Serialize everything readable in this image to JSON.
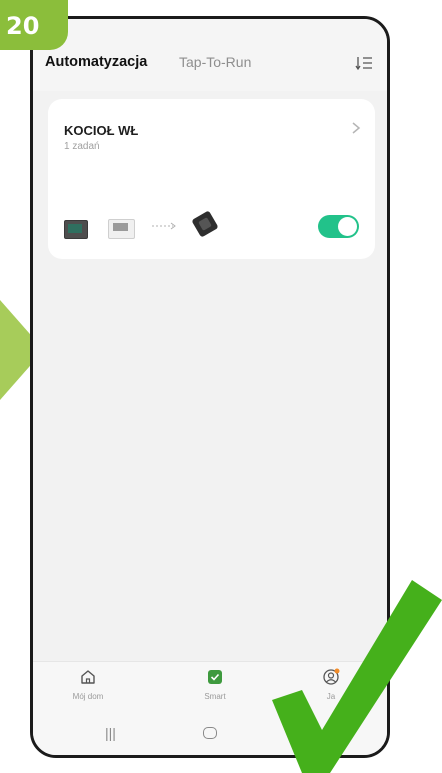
{
  "step": {
    "number": "20"
  },
  "header": {
    "tabs": [
      {
        "label": "Automatyzacja",
        "active": true
      },
      {
        "label": "Tap-To-Run",
        "active": false
      }
    ],
    "sort_icon": "sort-list-icon"
  },
  "automation_card": {
    "title": "KOCIOŁ WŁ",
    "subtitle": "1 zadań",
    "toggle_on": true,
    "toggle_color": "#22c28a"
  },
  "bottom_nav": {
    "items": [
      {
        "label": "Mój dom",
        "icon": "home-icon"
      },
      {
        "label": "Smart",
        "icon": "smart-check-icon"
      },
      {
        "label": "Ja",
        "icon": "profile-icon"
      }
    ]
  },
  "system_nav": {
    "recent": "|||"
  },
  "colors": {
    "accent_green": "#8bbe3b",
    "check_green": "#45b01b",
    "toggle": "#22c28a"
  }
}
